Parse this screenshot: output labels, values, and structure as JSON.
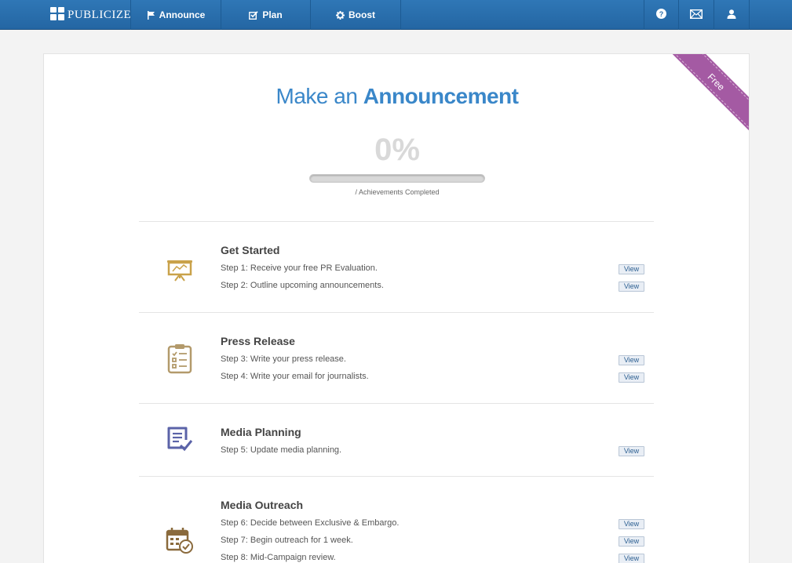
{
  "nav": {
    "logo_text": "Publicize",
    "announce_label": "Announce",
    "plan_label": "Plan",
    "boost_label": "Boost",
    "icons": [
      "flag-icon",
      "checkbox-icon",
      "gear-icon",
      "help-icon",
      "mail-icon",
      "user-icon"
    ]
  },
  "card": {
    "ribbon": "Free",
    "title_prefix": "Make an",
    "title_emphasis": "Announcement",
    "percent_text": "0%",
    "progress_fraction": 0,
    "progress_label": "/ Achievements Completed"
  },
  "sections": [
    {
      "title": "Get Started",
      "icon": "presentation-board-icon",
      "steps": [
        {
          "text": "Step 1: Receive your free PR Evaluation.",
          "action": "View"
        },
        {
          "text": "Step 2: Outline upcoming announcements.",
          "action": "View"
        }
      ]
    },
    {
      "title": "Press Release",
      "icon": "clipboard-checklist-icon",
      "steps": [
        {
          "text": "Step 3: Write your press release.",
          "action": "View"
        },
        {
          "text": "Step 4: Write your email for journalists.",
          "action": "View"
        }
      ]
    },
    {
      "title": "Media Planning",
      "icon": "document-check-icon",
      "steps": [
        {
          "text": "Step 5: Update media planning.",
          "action": "View"
        }
      ]
    },
    {
      "title": "Media Outreach",
      "icon": "calendar-check-icon",
      "steps": [
        {
          "text": "Step 6: Decide between Exclusive & Embargo.",
          "action": "View"
        },
        {
          "text": "Step 7: Begin outreach for 1 week.",
          "action": "View"
        },
        {
          "text": "Step 8: Mid-Campaign review.",
          "action": "View"
        }
      ]
    }
  ],
  "colors": {
    "nav_blue": "#2f77b6",
    "title_blue": "#3a87c9",
    "ribbon_purple": "#a45aa3",
    "icon_gold": "#c9a24a",
    "icon_tan": "#b39a6b",
    "icon_indigo": "#5b63a8",
    "icon_brown": "#8a6a3c"
  }
}
